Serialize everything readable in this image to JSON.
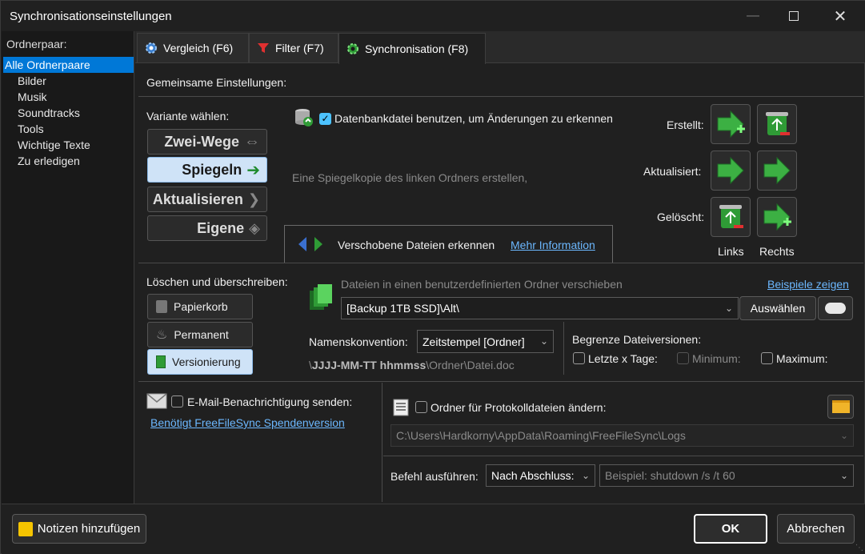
{
  "window": {
    "title": "Synchronisationseinstellungen"
  },
  "sidebar": {
    "label": "Ordnerpaar:",
    "items": [
      "Alle Ordnerpaare",
      "Bilder",
      "Musik",
      "Soundtracks",
      "Tools",
      "Wichtige Texte",
      "Zu erledigen"
    ],
    "selected": "Alle Ordnerpaare"
  },
  "tabs": [
    {
      "label": "Vergleich (F6)",
      "icon": "gear-icon"
    },
    {
      "label": "Filter (F7)",
      "icon": "filter-icon"
    },
    {
      "label": "Synchronisation (F8)",
      "icon": "sync-gear-icon"
    }
  ],
  "common": {
    "heading": "Gemeinsame Einstellungen:"
  },
  "variant": {
    "label": "Variante wählen:",
    "options": [
      "Zwei-Wege",
      "Spiegeln",
      "Aktualisieren",
      "Eigene"
    ],
    "selected": "Spiegeln",
    "description": "Eine Spiegelkopie des linken Ordners erstellen,"
  },
  "database": {
    "label": "Datenbankdatei benutzen, um Änderungen zu erkennen",
    "checked": true
  },
  "moved": {
    "label": "Verschobene Dateien erkennen",
    "link": "Mehr Information"
  },
  "actions": {
    "created": "Erstellt:",
    "updated": "Aktualisiert:",
    "deleted": "Gelöscht:",
    "left": "Links",
    "right": "Rechts"
  },
  "deletion": {
    "heading": "Löschen und überschreiben:",
    "options": [
      "Papierkorb",
      "Permanent",
      "Versionierung"
    ],
    "selected": "Versionierung",
    "move_label": "Dateien in einen benutzerdefinierten Ordner verschieben",
    "examples_link": "Beispiele zeigen",
    "folder_value": "[Backup 1TB SSD]\\Alt\\",
    "choose_button": "Auswählen",
    "naming_label": "Namenskonvention:",
    "naming_value": "Zeitstempel [Ordner]",
    "pattern_prefix": "\\",
    "pattern_bold": "JJJJ-MM-TT hhmmss",
    "pattern_suffix": "\\Ordner\\Datei.doc",
    "limit_heading": "Begrenze Dateiversionen:",
    "limit_last_days": "Letzte x Tage:",
    "limit_min": "Minimum:",
    "limit_max": "Maximum:"
  },
  "email": {
    "label": "E-Mail-Benachrichtigung senden:",
    "link": "Benötigt FreeFileSync Spendenversion"
  },
  "logs": {
    "label": "Ordner für Protokolldateien ändern:",
    "path": "C:\\Users\\Hardkorny\\AppData\\Roaming\\FreeFileSync\\Logs"
  },
  "command": {
    "label": "Befehl ausführen:",
    "when": "Nach Abschluss:",
    "placeholder": "Beispiel: shutdown /s /t 60"
  },
  "footer": {
    "notes_button": "Notizen hinzufügen",
    "ok_button": "OK",
    "cancel_button": "Abbrechen"
  },
  "colors": {
    "accent": "#0078d7",
    "link": "#6cb8ff",
    "green": "#3cb043",
    "selected_button": "#cfe3f7"
  }
}
